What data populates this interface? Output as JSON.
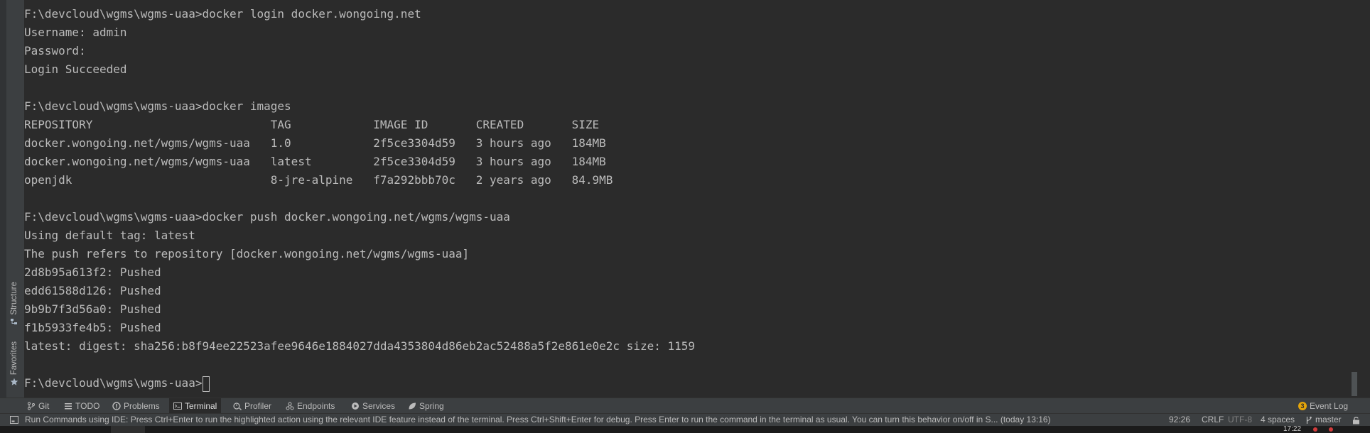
{
  "side_tabs": {
    "structure": "Structure",
    "favorites": "Favorites"
  },
  "terminal": {
    "lines": [
      "F:\\devcloud\\wgms\\wgms-uaa>docker login docker.wongoing.net",
      "Username: admin",
      "Password:",
      "Login Succeeded",
      "",
      "F:\\devcloud\\wgms\\wgms-uaa>docker images",
      "REPOSITORY                          TAG            IMAGE ID       CREATED       SIZE",
      "docker.wongoing.net/wgms/wgms-uaa   1.0            2f5ce3304d59   3 hours ago   184MB",
      "docker.wongoing.net/wgms/wgms-uaa   latest         2f5ce3304d59   3 hours ago   184MB",
      "openjdk                             8-jre-alpine   f7a292bbb70c   2 years ago   84.9MB",
      "",
      "F:\\devcloud\\wgms\\wgms-uaa>docker push docker.wongoing.net/wgms/wgms-uaa",
      "Using default tag: latest",
      "The push refers to repository [docker.wongoing.net/wgms/wgms-uaa]",
      "2d8b95a613f2: Pushed",
      "edd61588d126: Pushed",
      "9b9b7f3d56a0: Pushed",
      "f1b5933fe4b5: Pushed",
      "latest: digest: sha256:b8f94ee22523afee9646e1884027dda4353804d86eb2ac52488a5f2e861e0e2c size: 1159",
      ""
    ],
    "prompt": "F:\\devcloud\\wgms\\wgms-uaa>"
  },
  "tool_windows": {
    "git": "Git",
    "todo": "TODO",
    "problems": "Problems",
    "terminal": "Terminal",
    "profiler": "Profiler",
    "endpoints": "Endpoints",
    "services": "Services",
    "spring": "Spring",
    "event_log": "Event Log",
    "event_log_count": "3"
  },
  "status": {
    "message": "Run Commands using IDE: Press Ctrl+Enter to run the highlighted action using the relevant IDE feature instead of the terminal. Press Ctrl+Shift+Enter for debug. Press Enter to run the command in the terminal as usual. You can turn this behavior on/off in S... (today 13:16)",
    "position": "92:26",
    "line_separator": "CRLF",
    "encoding": "UTF-8",
    "indent": "4 spaces",
    "branch": "master"
  },
  "taskbar": {
    "time": "17:22"
  },
  "colors": {
    "accent_event": "#e5a50a",
    "active_tab_bg": "#2b2b2b",
    "terminal_bg": "#2b2b2b",
    "terminal_fg": "#bbbbbb"
  }
}
